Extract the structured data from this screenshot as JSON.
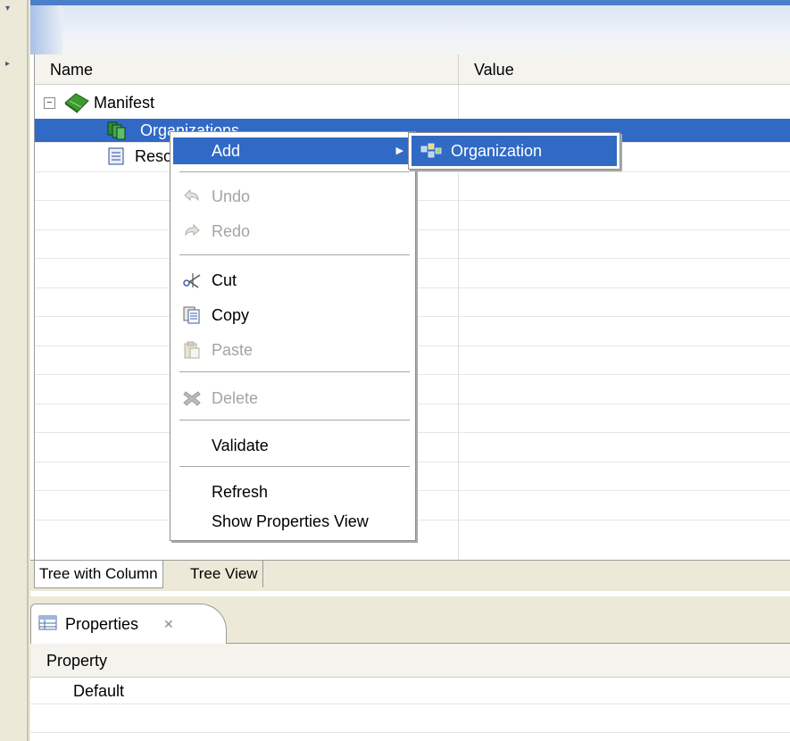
{
  "editor": {
    "columns": [
      "Name",
      "Value"
    ],
    "tree": {
      "root": "Manifest",
      "selected": "Organizations",
      "third": "Resources"
    },
    "tabs": [
      "Tree with Column",
      "Tree View"
    ]
  },
  "context_menu": {
    "items": [
      {
        "label": "Add",
        "enabled": true,
        "highlighted": true,
        "submenu": true
      },
      {
        "label": "Undo",
        "enabled": false,
        "icon": "undo-icon"
      },
      {
        "label": "Redo",
        "enabled": false,
        "icon": "redo-icon"
      },
      {
        "label": "Cut",
        "enabled": true,
        "icon": "scissors-icon"
      },
      {
        "label": "Copy",
        "enabled": true,
        "icon": "copy-icon"
      },
      {
        "label": "Paste",
        "enabled": false,
        "icon": "paste-icon"
      },
      {
        "label": "Delete",
        "enabled": false,
        "icon": "delete-icon"
      },
      {
        "label": "Validate",
        "enabled": true
      },
      {
        "label": "Refresh",
        "enabled": true
      },
      {
        "label": "Show Properties View",
        "enabled": true
      }
    ],
    "submenu": {
      "label": "Organization",
      "icon": "organization-icon"
    }
  },
  "properties_view": {
    "tab_label": "Properties",
    "column": "Property",
    "rows": [
      "Default"
    ]
  },
  "colors": {
    "selection": "#316ac5",
    "chrome": "#ece9d8",
    "disabled_text": "#a4a4a4"
  }
}
